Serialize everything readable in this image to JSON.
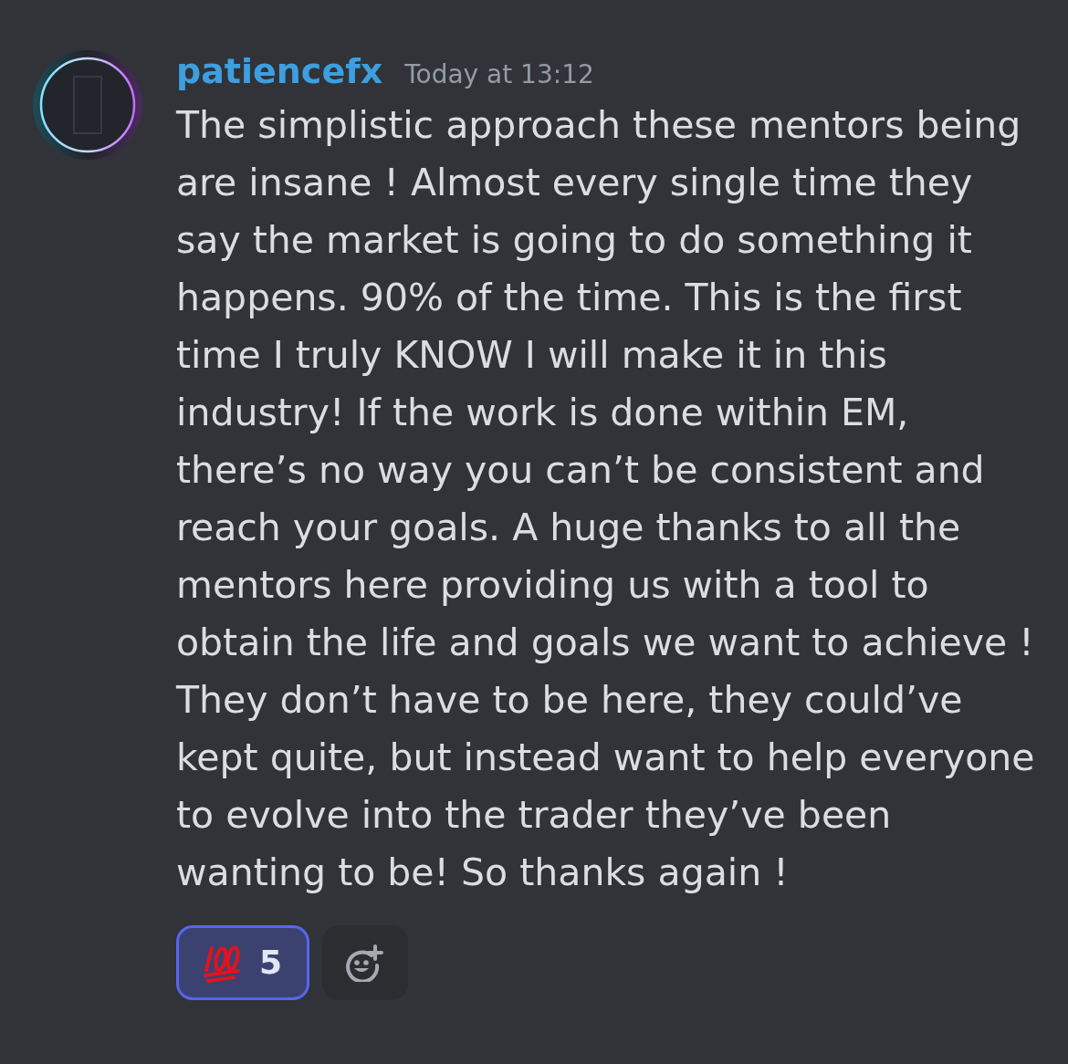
{
  "message": {
    "author": "patiencefx",
    "timestamp": "Today at 13:12",
    "text": "The simplistic approach these mentors being are insane ! Almost every single time they say the market is going to do something it happens. 90% of the time. This is the first time I truly KNOW I will make it in this industry! If the work is done within EM, there’s no way you can’t be consistent and reach your goals. A huge thanks to all the mentors here providing us with a tool to obtain the life and goals we want to achieve ! They don’t have to be here, they could’ve kept quite, but instead want to help everyone to evolve into the trader they’ve been wanting to be! So thanks again !",
    "reactions": [
      {
        "count": "5",
        "selected": true
      }
    ]
  }
}
